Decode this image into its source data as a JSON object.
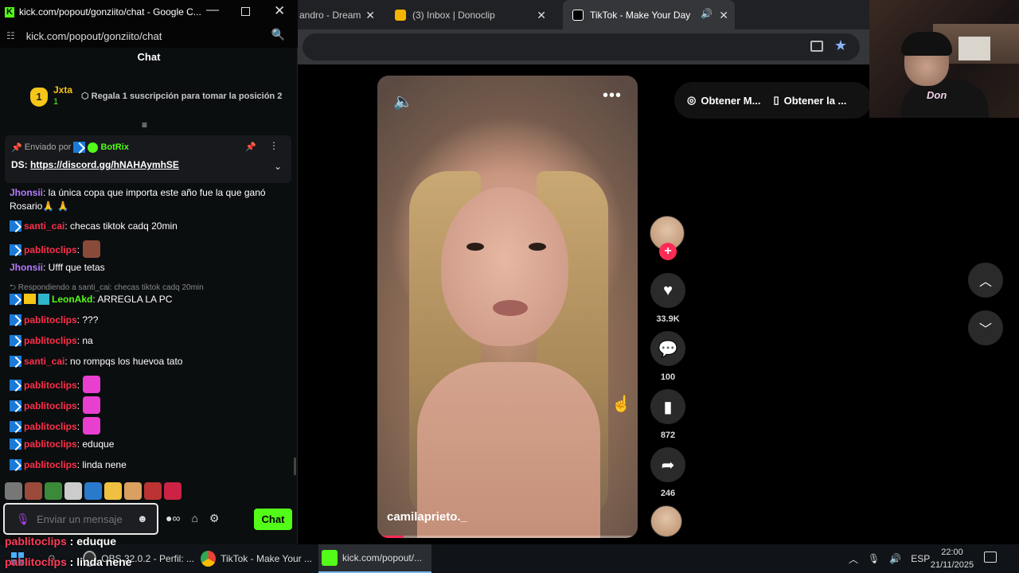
{
  "browser": {
    "tabs": [
      {
        "title": "andro - Dream",
        "fav_color": "#202124"
      },
      {
        "title": "(3) Inbox | Donoclip",
        "fav_color": "#f5b400"
      },
      {
        "title": "TikTok - Make Your Day",
        "fav_color": "#000000"
      }
    ],
    "new_tab": "+"
  },
  "tiktok": {
    "username": "camilaprieto._",
    "likes": "33.9K",
    "comments": "100",
    "saves": "872",
    "shares": "246",
    "get_app_1": "Obtener M...",
    "get_app_2": "Obtener la ...",
    "progress_fraction": 0.1
  },
  "webcam": {
    "shirt_text": "Don"
  },
  "chat_window": {
    "title": "kick.com/popout/gonziito/chat - Google C...",
    "url": "kick.com/popout/gonziito/chat",
    "header": "Chat",
    "gift": {
      "rank": "1",
      "name": "Jxta",
      "count": "1",
      "text": "Regala 1 suscripción para tomar la posición 2"
    },
    "pinned": {
      "sent_by": "Enviado por",
      "author": "BotRix",
      "label": "DS:",
      "link": "https://discord.gg/hNAHAymhSE"
    },
    "messages": [
      {
        "user": "Jhonsii",
        "color": "#b57cff",
        "text": ": la única copa que importa este año fue la que ganó Rosario🙏 🙏",
        "badge": false
      },
      {
        "user": "santi_cai",
        "color": "#ff2f4a",
        "text": ": checas tiktok cadq 20min",
        "badge": true
      },
      {
        "user": "pablitoclips",
        "color": "#ff2f4a",
        "text": ":",
        "badge": true,
        "emote": "#8a4a3a"
      },
      {
        "user": "Jhonsii",
        "color": "#b57cff",
        "text": ": Ufff que tetas",
        "badge": false
      },
      {
        "user": "LeonAkd",
        "color": "#53fc18",
        "text": ": ARREGLA LA PC",
        "badge": true,
        "extra": true
      },
      {
        "user": "pablitoclips",
        "color": "#ff2f4a",
        "text": ": ???",
        "badge": true
      },
      {
        "user": "pablitoclips",
        "color": "#ff2f4a",
        "text": ": na",
        "badge": true
      },
      {
        "user": "santi_cai",
        "color": "#ff2f4a",
        "text": ": no rompqs los huevoa tato",
        "badge": true
      },
      {
        "user": "pablitoclips",
        "color": "#ff2f4a",
        "text": ":",
        "badge": true,
        "emote": "#e83fd0"
      },
      {
        "user": "pablitoclips",
        "color": "#ff2f4a",
        "text": ":",
        "badge": true,
        "emote": "#e83fd0"
      },
      {
        "user": "pablitoclips",
        "color": "#ff2f4a",
        "text": ":",
        "badge": true,
        "emote": "#e83fd0"
      },
      {
        "user": "pablitoclips",
        "color": "#ff2f4a",
        "text": ": eduque",
        "badge": true
      },
      {
        "user": "pablitoclips",
        "color": "#ff2f4a",
        "text": ": linda nene",
        "badge": true
      }
    ],
    "reply_hint": "Respondiendo a santi_cai: checas tiktok cadq 20min",
    "input_placeholder": "Enviar un mensaje",
    "send_label": "Chat",
    "emote_colors": [
      "#777777",
      "#9a4a3a",
      "#3a8a3a",
      "#cccccc",
      "#2a7acc",
      "#f0c040",
      "#d9a060",
      "#bb3333",
      "#cc2244"
    ]
  },
  "overlay": {
    "line1_user": "pablitoclips",
    "line1_text": " : eduque",
    "line2_user": "pablitoclips",
    "line2_text": " : linda nene"
  },
  "taskbar": {
    "items": [
      {
        "label": "OBS 32.0.2 - Perfil: ..."
      },
      {
        "label": "TikTok - Make Your ..."
      },
      {
        "label": "kick.com/popout/..."
      }
    ],
    "lang": "ESP",
    "time": "22:00",
    "date": "21/11/2025"
  }
}
